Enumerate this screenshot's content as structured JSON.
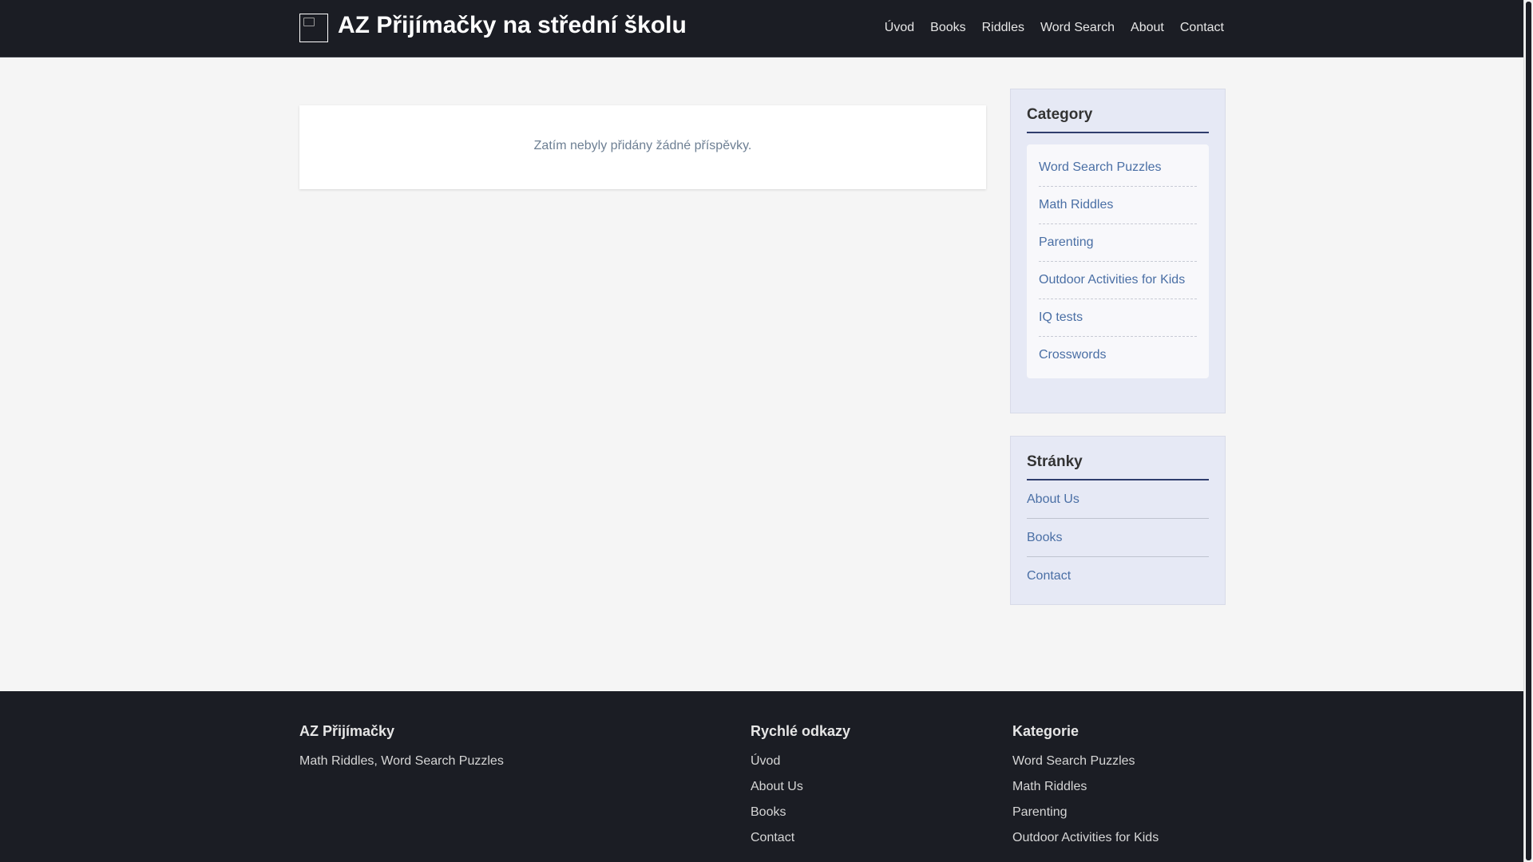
{
  "header": {
    "site_title": "AZ Přijímačky na střední školu",
    "nav": [
      "Úvod",
      "Books",
      "Riddles",
      "Word Search",
      "About",
      "Contact"
    ]
  },
  "main": {
    "empty_message": "Zatím nebyly přidány žádné příspěvky."
  },
  "sidebar": {
    "category": {
      "title": "Category",
      "items": [
        "Word Search Puzzles",
        "Math Riddles",
        "Parenting",
        "Outdoor Activities for Kids",
        "IQ tests",
        "Crosswords"
      ]
    },
    "pages": {
      "title": "Stránky",
      "items": [
        "About Us",
        "Books",
        "Contact"
      ]
    }
  },
  "footer": {
    "about": {
      "title": "AZ Přijímačky",
      "text": "Math Riddles, Word Search Puzzles"
    },
    "quick_links": {
      "title": "Rychlé odkazy",
      "items": [
        "Úvod",
        "About Us",
        "Books",
        "Contact"
      ]
    },
    "categories": {
      "title": "Kategorie",
      "items": [
        "Word Search Puzzles",
        "Math Riddles",
        "Parenting",
        "Outdoor Activities for Kids"
      ]
    }
  }
}
